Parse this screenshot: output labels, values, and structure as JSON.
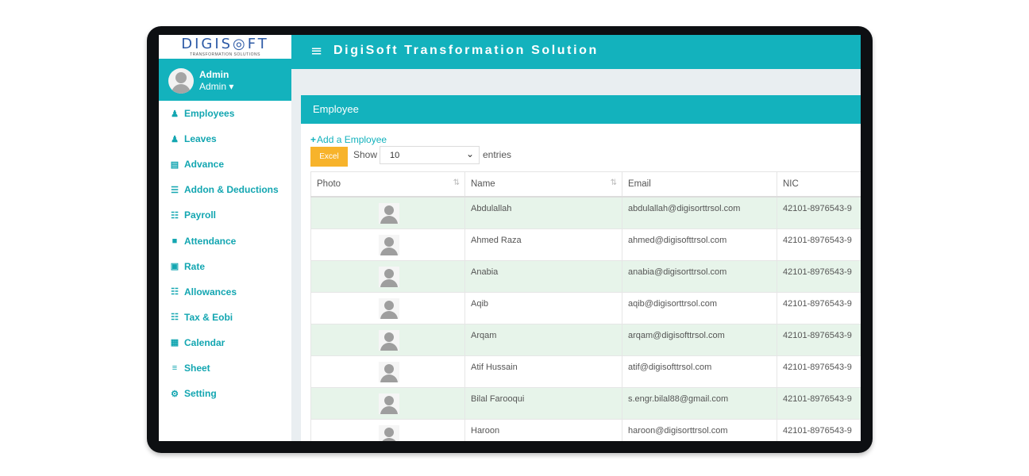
{
  "logo": {
    "main": "DIGIS◎FT",
    "sub": "TRANSFORMATION SOLUTIONS"
  },
  "user": {
    "name": "Admin",
    "role": "Admin ▾"
  },
  "menu_icon": "≡",
  "app_title": "DigiSoft Transformation Solution",
  "sidebar": {
    "items": [
      {
        "label": "Employees",
        "icon": "user-icon",
        "glyph": "♟"
      },
      {
        "label": "Leaves",
        "icon": "user-icon",
        "glyph": "♟"
      },
      {
        "label": "Advance",
        "icon": "money-icon",
        "glyph": "▤"
      },
      {
        "label": "Addon & Deductions",
        "icon": "list-icon",
        "glyph": "☰"
      },
      {
        "label": "Payroll",
        "icon": "sitemap-icon",
        "glyph": "☷"
      },
      {
        "label": "Attendance",
        "icon": "clipboard-icon",
        "glyph": "■"
      },
      {
        "label": "Rate",
        "icon": "id-card-icon",
        "glyph": "▣"
      },
      {
        "label": "Allowances",
        "icon": "sitemap-icon",
        "glyph": "☷"
      },
      {
        "label": "Tax & Eobi",
        "icon": "sitemap-icon",
        "glyph": "☷"
      },
      {
        "label": "Calendar",
        "icon": "calendar-icon",
        "glyph": "▦"
      },
      {
        "label": "Sheet",
        "icon": "database-icon",
        "glyph": "≡"
      },
      {
        "label": "Setting",
        "icon": "gears-icon",
        "glyph": "⚙"
      }
    ]
  },
  "panel": {
    "title": "Employee",
    "add_label": "Add a Employee",
    "excel_label": "Excel",
    "show_label": "Show",
    "entries_value": "10",
    "entries_label": "entries"
  },
  "table": {
    "columns": [
      "Photo",
      "Name",
      "Email",
      "NIC"
    ],
    "rows": [
      {
        "name": "Abdulallah",
        "email": "abdulallah@digisorttrsol.com",
        "nic": "42101-8976543-9"
      },
      {
        "name": "Ahmed Raza",
        "email": "ahmed@digisofttrsol.com",
        "nic": "42101-8976543-9"
      },
      {
        "name": "Anabia",
        "email": "anabia@digisorttrsol.com",
        "nic": "42101-8976543-9"
      },
      {
        "name": "Aqib",
        "email": "aqib@digisorttrsol.com",
        "nic": "42101-8976543-9"
      },
      {
        "name": "Arqam",
        "email": "arqam@digisofttrsol.com",
        "nic": "42101-8976543-9"
      },
      {
        "name": "Atif Hussain",
        "email": "atif@digisofttrsol.com",
        "nic": "42101-8976543-9"
      },
      {
        "name": "Bilal Farooqui",
        "email": "s.engr.bilal88@gmail.com",
        "nic": "42101-8976543-9"
      },
      {
        "name": "Haroon",
        "email": "haroon@digisorttrsol.com",
        "nic": "42101-8976543-9"
      }
    ]
  },
  "colors": {
    "accent": "#13b2bd",
    "excel": "#f7b32b",
    "row_alt": "#e7f4ea",
    "device": "#0d0f12"
  }
}
